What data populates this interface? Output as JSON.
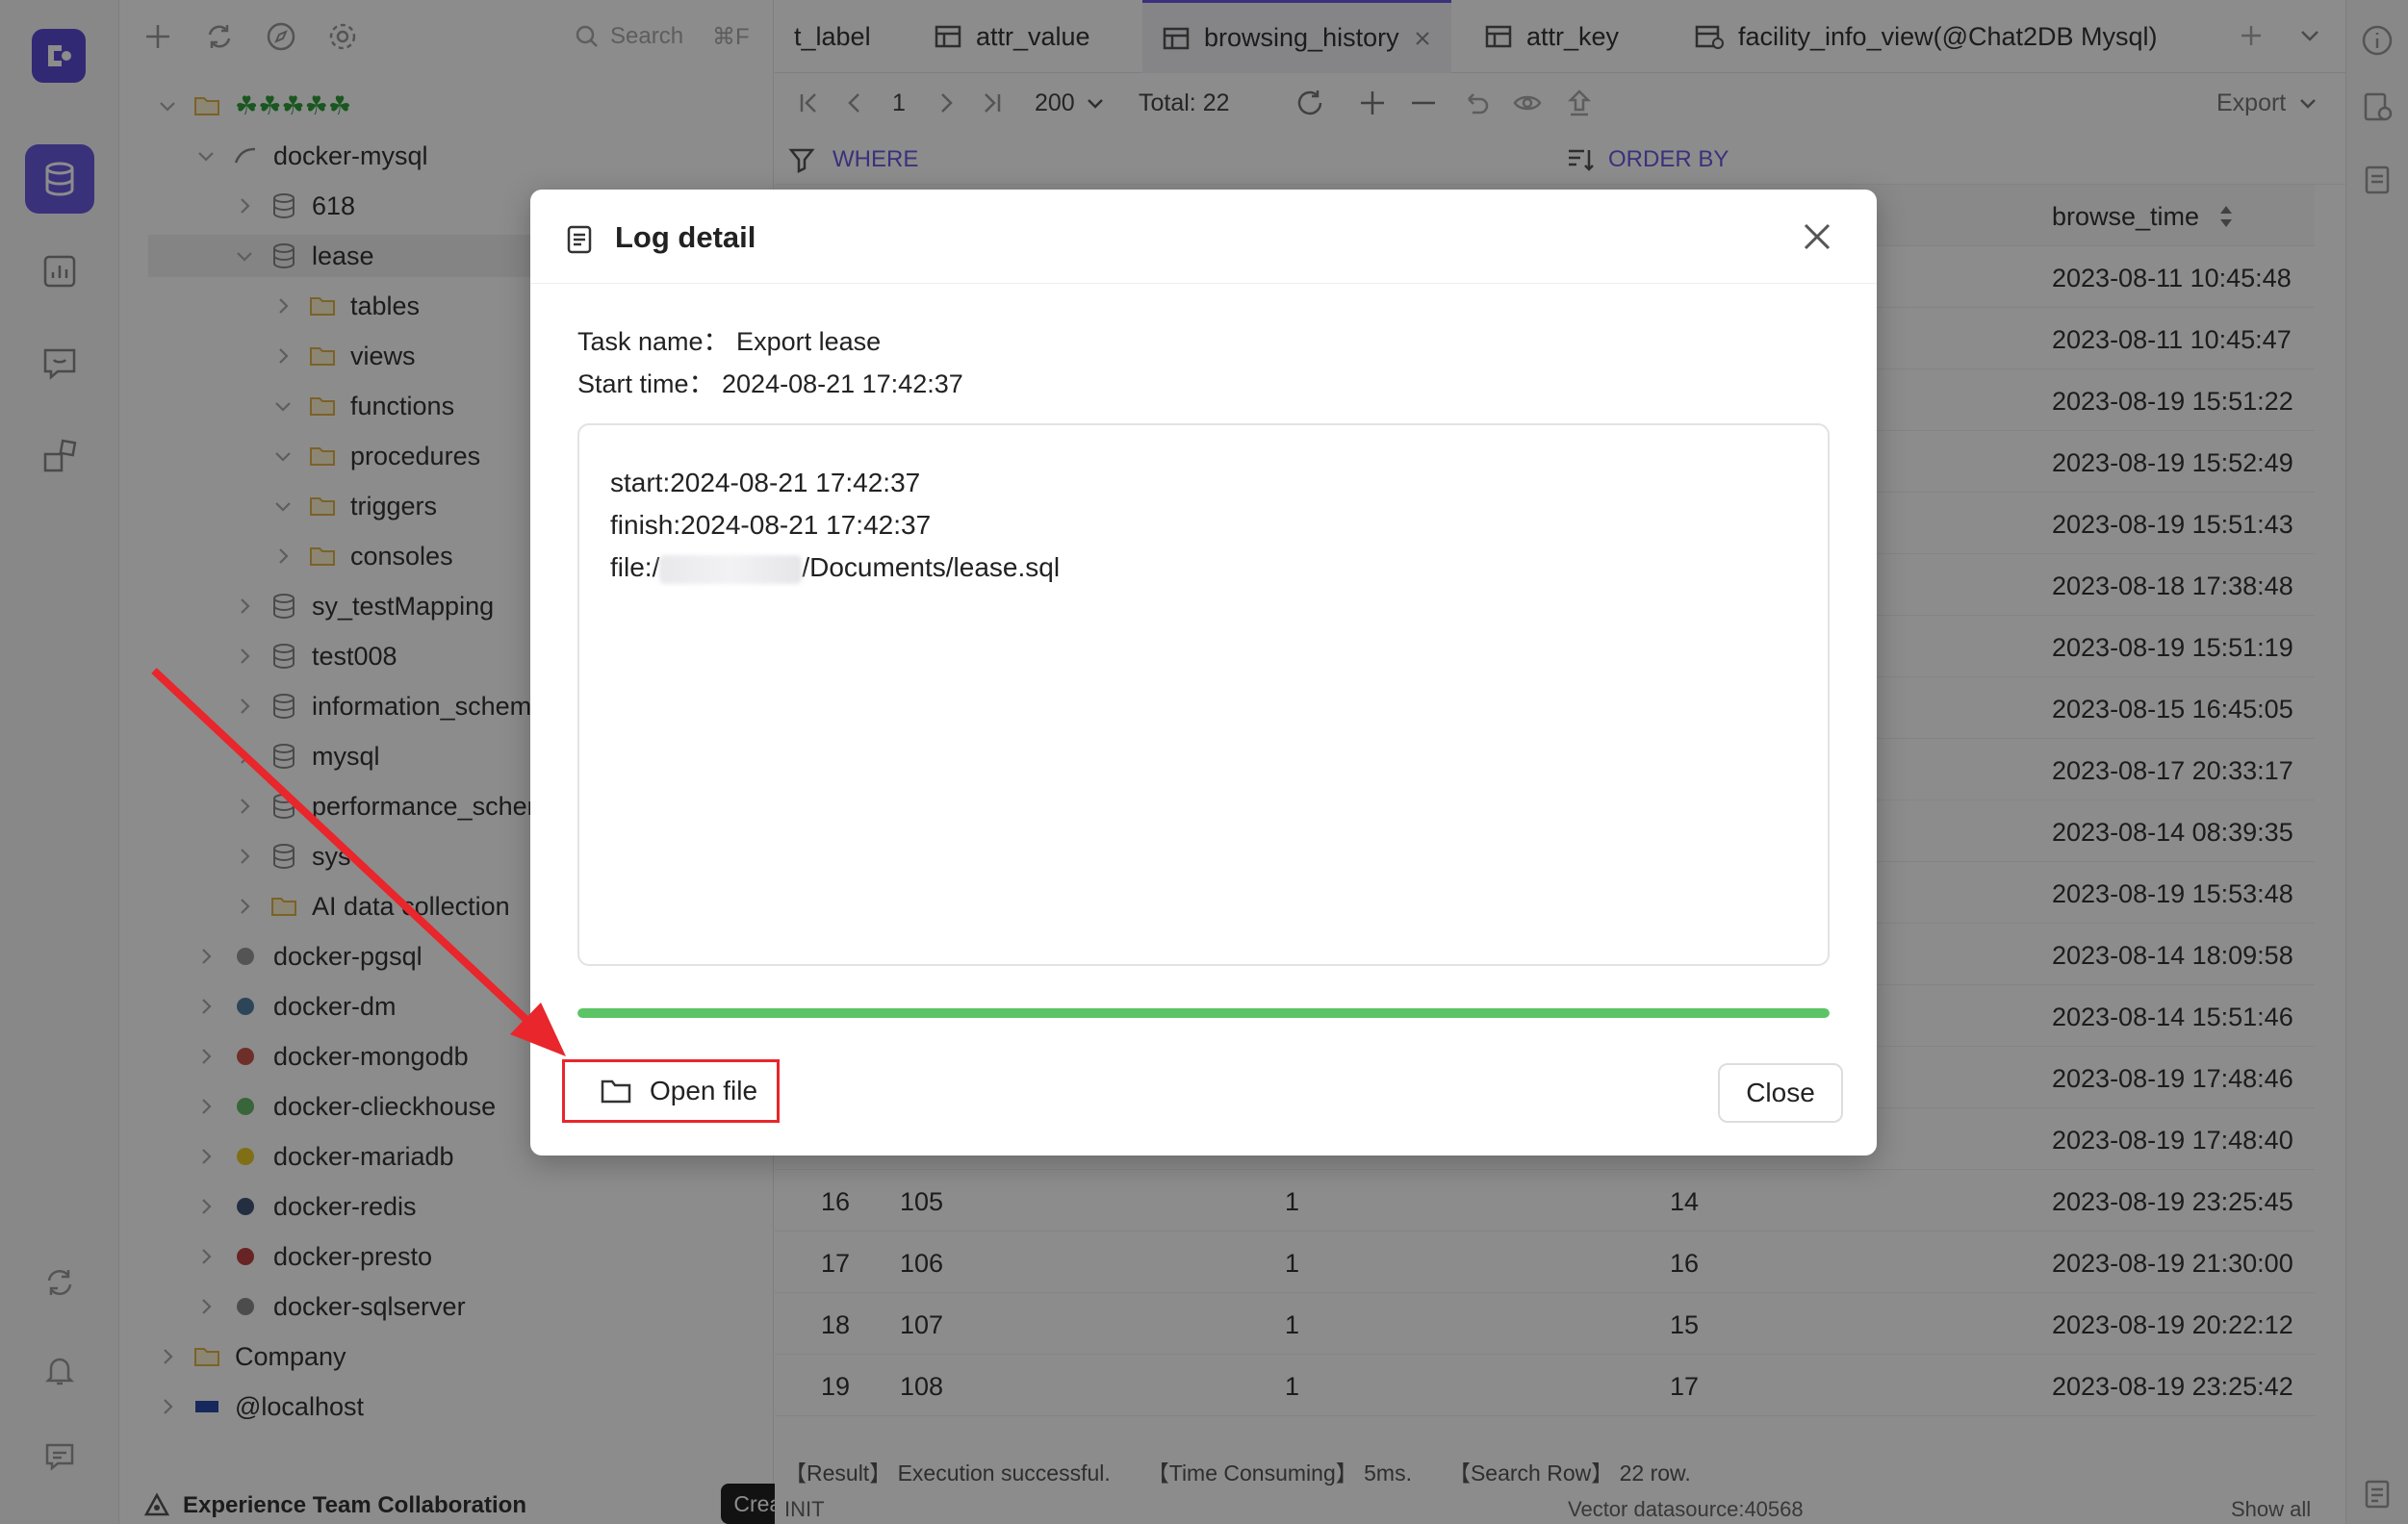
{
  "sidebar": {
    "search_placeholder": "Search",
    "search_shortcut": "⌘F",
    "tree": [
      {
        "label": "☘☘☘☘☘",
        "level": 0
      },
      {
        "label": "docker-mysql",
        "level": 1
      },
      {
        "label": "618",
        "level": 2
      },
      {
        "label": "lease",
        "level": 2
      },
      {
        "label": "tables",
        "level": 3
      },
      {
        "label": "views",
        "level": 3
      },
      {
        "label": "functions",
        "level": 3
      },
      {
        "label": "procedures",
        "level": 3
      },
      {
        "label": "triggers",
        "level": 3
      },
      {
        "label": "consoles",
        "level": 3
      },
      {
        "label": "sy_testMapping",
        "level": 2
      },
      {
        "label": "test008",
        "level": 2
      },
      {
        "label": "information_schema",
        "level": 2
      },
      {
        "label": "mysql",
        "level": 2
      },
      {
        "label": "performance_schema",
        "level": 2
      },
      {
        "label": "sys",
        "level": 2
      },
      {
        "label": "AI data collection",
        "level": 2
      },
      {
        "label": "docker-pgsql",
        "level": 1
      },
      {
        "label": "docker-dm",
        "level": 1
      },
      {
        "label": "docker-mongodb",
        "level": 1
      },
      {
        "label": "docker-clieckhouse",
        "level": 1
      },
      {
        "label": "docker-mariadb",
        "level": 1
      },
      {
        "label": "docker-redis",
        "level": 1
      },
      {
        "label": "docker-presto",
        "level": 1
      },
      {
        "label": "docker-sqlserver",
        "level": 1
      },
      {
        "label": "Company",
        "level": 0
      },
      {
        "label": "@localhost",
        "level": 0
      }
    ],
    "team_label": "Experience Team Collaboration",
    "create_team": "Create Team"
  },
  "tabs": [
    {
      "label": "t_label"
    },
    {
      "label": "attr_value"
    },
    {
      "label": "browsing_history"
    },
    {
      "label": "attr_key"
    },
    {
      "label": "facility_info_view(@Chat2DB Mysql)"
    }
  ],
  "toolbar": {
    "page": "1",
    "page_size": "200",
    "total": "Total: 22",
    "export": "Export"
  },
  "filter": {
    "where": "WHERE",
    "order_by": "ORDER BY"
  },
  "grid": {
    "col_browse_time": "browse_time",
    "browse_times": [
      "2023-08-11 10:45:48",
      "2023-08-11 10:45:47",
      "2023-08-19 15:51:22",
      "2023-08-19 15:52:49",
      "2023-08-19 15:51:43",
      "2023-08-18 17:38:48",
      "2023-08-19 15:51:19",
      "2023-08-15 16:45:05",
      "2023-08-17 20:33:17",
      "2023-08-14 08:39:35",
      "2023-08-19 15:53:48",
      "2023-08-14 18:09:58",
      "2023-08-14 15:51:46",
      "2023-08-19 17:48:46",
      "2023-08-19 17:48:40"
    ],
    "rows": [
      {
        "n": "16",
        "id": "105",
        "c3": "1",
        "c4": "14",
        "time": "2023-08-19 23:25:45"
      },
      {
        "n": "17",
        "id": "106",
        "c3": "1",
        "c4": "16",
        "time": "2023-08-19 21:30:00"
      },
      {
        "n": "18",
        "id": "107",
        "c3": "1",
        "c4": "15",
        "time": "2023-08-19 20:22:12"
      },
      {
        "n": "19",
        "id": "108",
        "c3": "1",
        "c4": "17",
        "time": "2023-08-19 23:25:42"
      }
    ]
  },
  "status": {
    "result": "【Result】 Execution successful.",
    "time": "【Time Consuming】 5ms.",
    "rows": "【Search Row】 22 row."
  },
  "bottom": {
    "left": "INIT",
    "mid": "Vector datasource:40568",
    "right": "Show all"
  },
  "modal": {
    "title": "Log detail",
    "task_name": "Task name：  Export lease",
    "start_time": "Start time：  2024-08-21 17:42:37",
    "log_start": "start:2024-08-21 17:42:37",
    "log_finish": "finish:2024-08-21 17:42:37",
    "log_file_prefix": "file:/",
    "log_file_suffix": "/Documents/lease.sql",
    "progress": 1.0,
    "open_file": "Open file",
    "close": "Close"
  },
  "colors": {
    "accent": "#6a5ae0",
    "progress": "#5cc466",
    "highlight": "#e8262b"
  }
}
